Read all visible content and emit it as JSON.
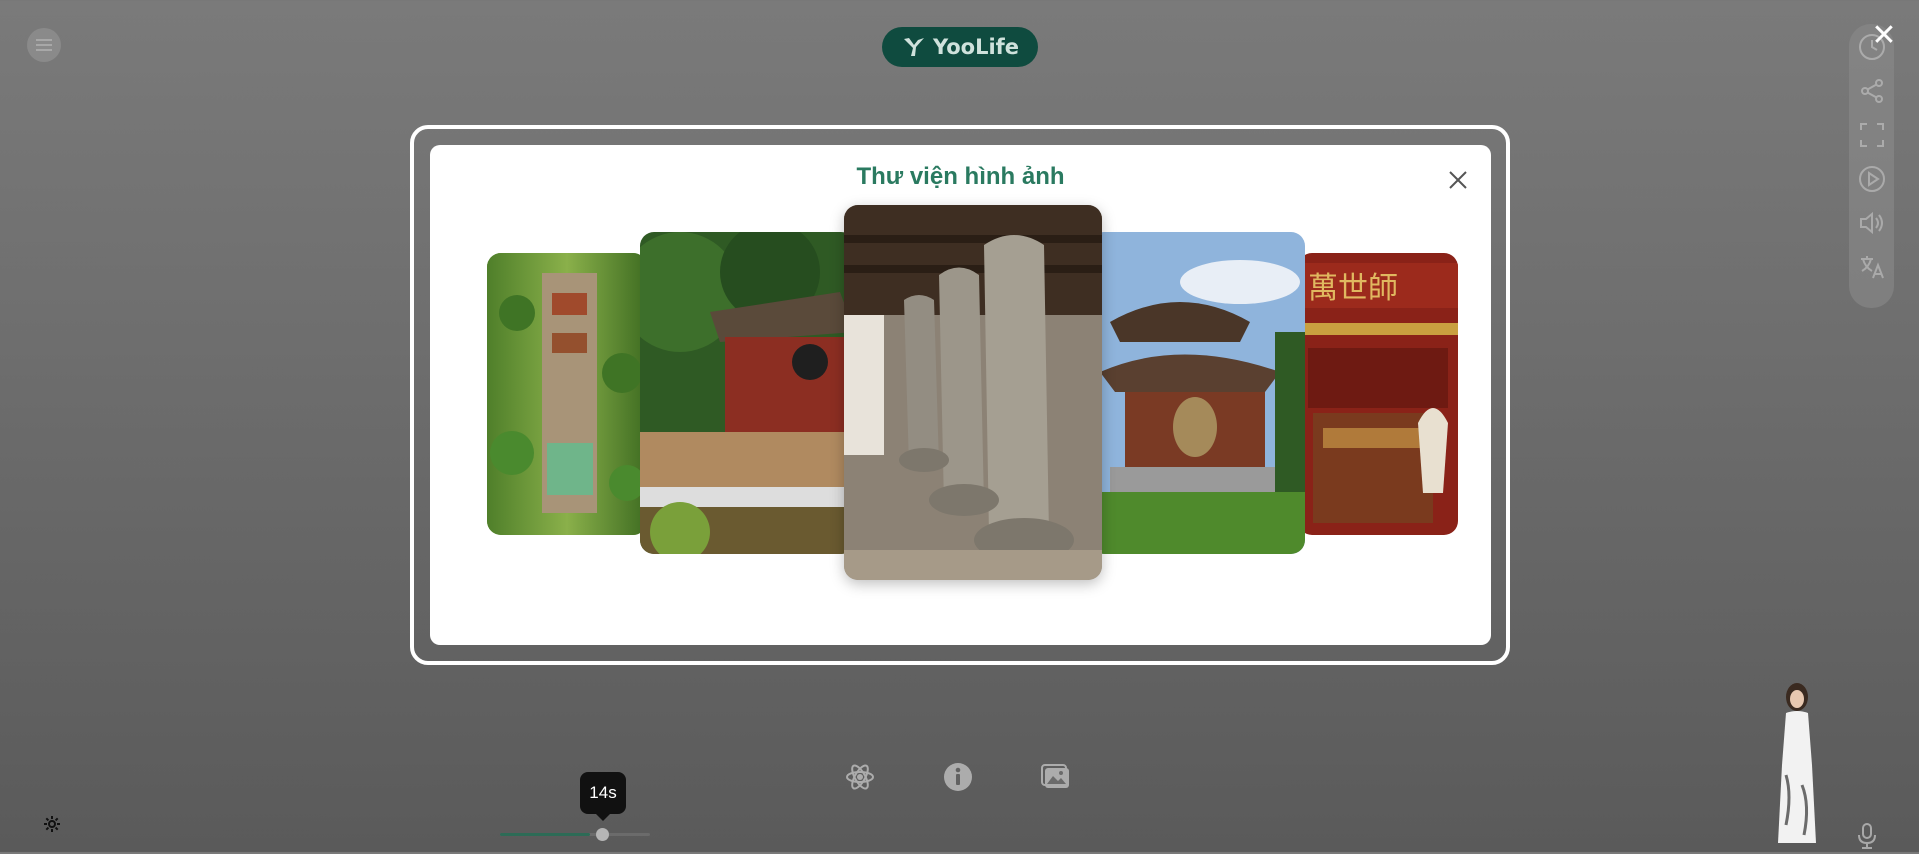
{
  "app": {
    "logo_text": "YooLife",
    "logo_bg": "#0f4b3f"
  },
  "gallery": {
    "title": "Thư viện hình ảnh",
    "title_color": "#2a7a60",
    "slides": [
      {
        "name": "aerial-view-temple-complex"
      },
      {
        "name": "red-gate-pavilion"
      },
      {
        "name": "stone-stelae-on-turtles"
      },
      {
        "name": "drum-pavilion"
      },
      {
        "name": "red-altar-with-calligraphy"
      }
    ],
    "dots": [
      {
        "active": false
      },
      {
        "active": true
      },
      {
        "active": false
      },
      {
        "active": false
      },
      {
        "active": false
      }
    ],
    "active_dot_color": "#1a7cf0"
  },
  "player": {
    "time_tooltip": "14s",
    "progress_fraction": 0.6
  },
  "icons": {
    "menu": "menu-icon",
    "close": "close-icon",
    "right_rail": [
      "clock-icon",
      "share-icon",
      "fullscreen-icon",
      "play-icon",
      "volume-icon",
      "translate-icon"
    ],
    "bottom": [
      "atom-icon",
      "info-icon",
      "gallery-icon"
    ],
    "settings": "gear-icon",
    "mic": "microphone-icon"
  }
}
